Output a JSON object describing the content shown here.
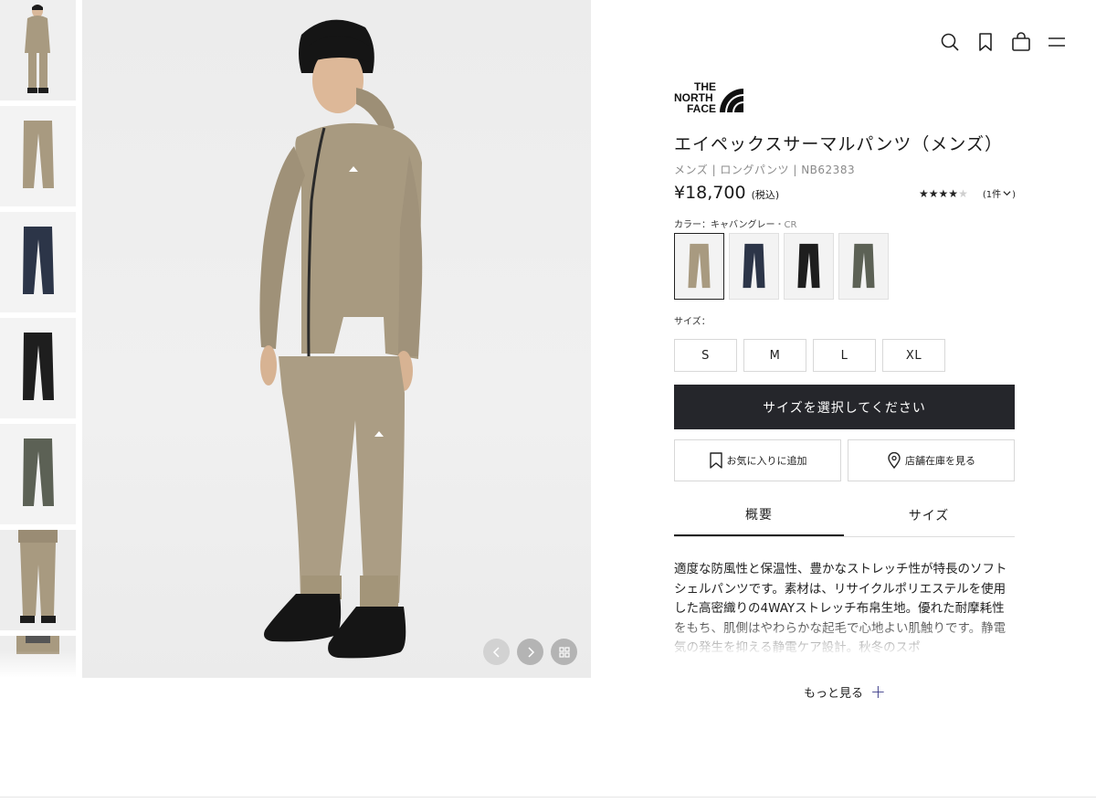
{
  "header": {
    "icons": [
      "search-icon",
      "bookmark-icon",
      "cart-icon",
      "menu-icon"
    ]
  },
  "brand": {
    "logo_lines": [
      "THE",
      "NORTH",
      "FACE"
    ]
  },
  "product": {
    "title": "エイペックスサーマルパンツ（メンズ）",
    "meta": "メンズ | ロングパンツ | NB62383",
    "price": "¥18,700",
    "tax_note": "(税込)",
    "rating_stars_filled": 4,
    "rating_stars_total": 5,
    "review_count": "(1件",
    "color_label": "カラー：キャバングレー",
    "color_code": "・CR",
    "colors": [
      {
        "name": "キャバングレー",
        "hex": "#a89a80"
      },
      {
        "name": "navy",
        "hex": "#2c3548"
      },
      {
        "name": "black",
        "hex": "#1e1e1e"
      },
      {
        "name": "gray-green",
        "hex": "#5c6155"
      }
    ],
    "size_label": "サイズ：",
    "sizes": [
      "S",
      "M",
      "L",
      "XL"
    ]
  },
  "actions": {
    "cta": "サイズを選択してください",
    "favorite": "お気に入りに追加",
    "store_stock": "店舗在庫を見る"
  },
  "tabs": {
    "overview": "概要",
    "size": "サイズ"
  },
  "description": "適度な防風性と保温性、豊かなストレッチ性が特長のソフトシェルパンツです。素材は、リサイクルポリエステルを使用した高密織りの4WAYストレッチ布帛生地。優れた耐摩耗性をもち、肌側はやわらかな起毛で心地よい肌触りです。静電気の発生を抑える静電ケア設計。秋冬のスポ",
  "more_label": "もっと見る",
  "colors": {
    "cta_bg": "#25262b",
    "product_beige": "#a89a80"
  }
}
